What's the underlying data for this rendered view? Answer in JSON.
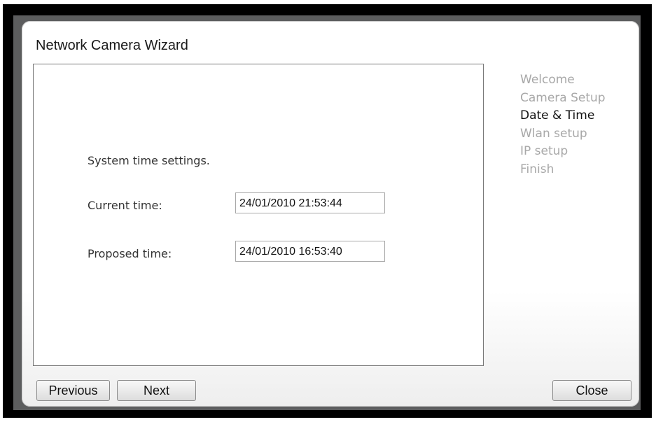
{
  "window": {
    "title": "Network Camera Wizard"
  },
  "content": {
    "heading": "System time settings.",
    "current_time": {
      "label": "Current time:",
      "value": "24/01/2010 21:53:44"
    },
    "proposed_time": {
      "label": "Proposed time:",
      "value": "24/01/2010 16:53:40"
    }
  },
  "steps": {
    "items": [
      {
        "label": "Welcome"
      },
      {
        "label": "Camera Setup"
      },
      {
        "label": "Date & Time"
      },
      {
        "label": "Wlan setup"
      },
      {
        "label": "IP setup"
      },
      {
        "label": "Finish"
      }
    ],
    "active_index": 2
  },
  "buttons": {
    "previous": "Previous",
    "next": "Next",
    "close": "Close"
  },
  "colors": {
    "active_step": "#111111",
    "inactive_step": "#a8a8a8",
    "frame": "#5c5d5e"
  }
}
